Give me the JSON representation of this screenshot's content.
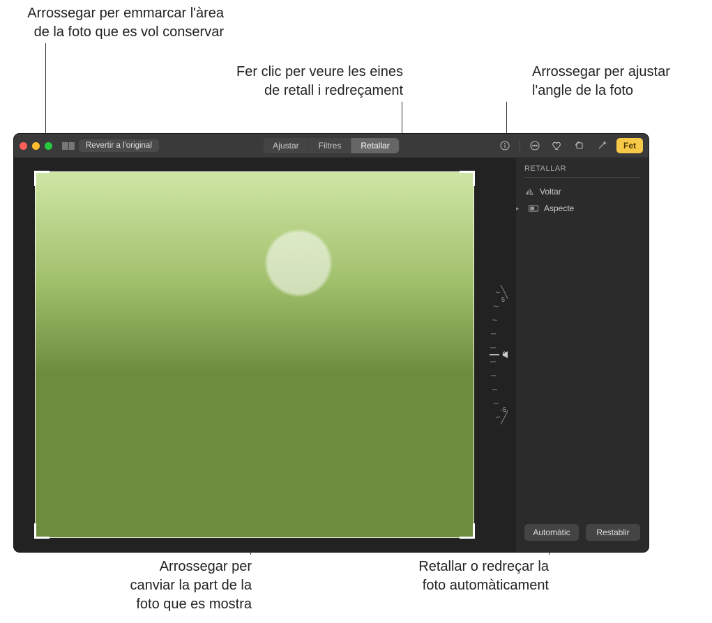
{
  "callouts": {
    "frame": "Arrossegar per emmarcar l'àrea\nde la foto que es vol conservar",
    "tools": "Fer clic per veure les eines\nde retall i redreçament",
    "angle": "Arrossegar per ajustar\nl'angle de la foto",
    "drag_photo": "Arrossegar per\ncanviar la part de la\nfoto que es mostra",
    "auto": "Retallar o redreçar la\nfoto automàticament"
  },
  "toolbar": {
    "revert": "Revertir a l'original",
    "adjust": "Ajustar",
    "filters": "Filtres",
    "crop": "Retallar",
    "done": "Fet"
  },
  "sidebar": {
    "title": "RETALLAR",
    "flip": "Voltar",
    "aspect": "Aspecte",
    "auto": "Automàtic",
    "reset": "Restablir"
  },
  "dial": {
    "top": "5",
    "center": "0",
    "bottom": "-5"
  }
}
